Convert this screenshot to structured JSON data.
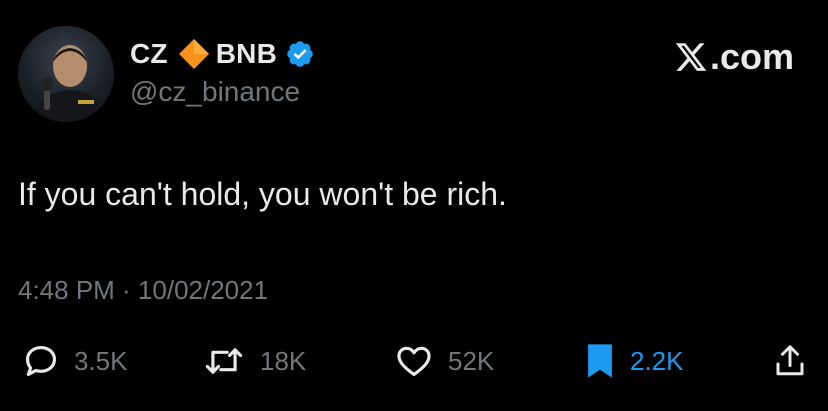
{
  "author": {
    "display_name_left": "CZ",
    "display_name_right": "BNB",
    "handle": "@cz_binance",
    "diamond_icon": "orange-diamond-icon",
    "verified_icon": "verified-badge-icon"
  },
  "brand": {
    "text": ".com",
    "logo_icon": "x-logo-icon"
  },
  "tweet": {
    "text": "If you can't hold, you won't be rich.",
    "timestamp": "4:48 PM · 10/02/2021"
  },
  "actions": {
    "reply_count": "3.5K",
    "retweet_count": "18K",
    "like_count": "52K",
    "bookmark_count": "2.2K"
  },
  "colors": {
    "background": "#000000",
    "text": "#e7e9ea",
    "muted": "#71767b",
    "accent_blue": "#1d9bf0",
    "diamond_orange": "#f7931a"
  }
}
